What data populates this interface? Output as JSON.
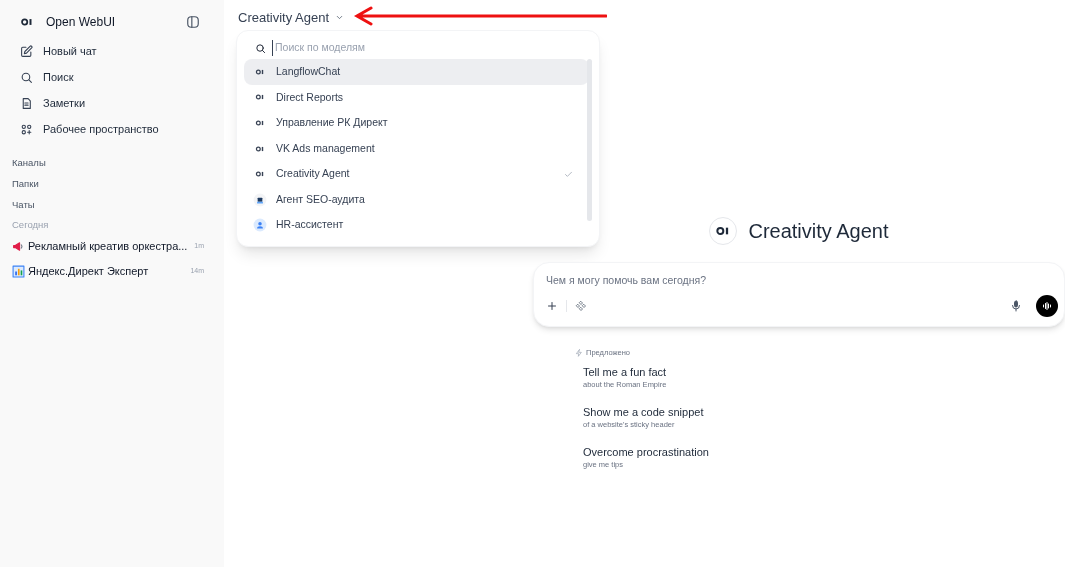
{
  "sidebar": {
    "app_name": "Open WebUI",
    "nav": [
      {
        "kind": "new-chat",
        "label": "Новый чат"
      },
      {
        "kind": "search",
        "label": "Поиск"
      },
      {
        "kind": "notes",
        "label": "Заметки"
      },
      {
        "kind": "workspace",
        "label": "Рабочее пространство"
      }
    ],
    "sections": [
      "Каналы",
      "Папки",
      "Чаты"
    ],
    "group_label": "Сегодня",
    "chats": [
      {
        "kind": "megaphone",
        "title": "Рекламный креатив оркестра...",
        "time": "1m"
      },
      {
        "kind": "chart",
        "title": "Яндекс.Директ Эксперт",
        "time": "14m"
      }
    ]
  },
  "model_selector": {
    "label": "Creativity Agent",
    "expanded": true,
    "search_placeholder": "Поиск по моделям",
    "models": [
      {
        "kind": "logo",
        "name": "LangflowChat",
        "highlighted": true,
        "selected": false
      },
      {
        "kind": "logo",
        "name": "Direct Reports",
        "highlighted": false,
        "selected": false
      },
      {
        "kind": "logo",
        "name": "Управление РК Директ",
        "highlighted": false,
        "selected": false
      },
      {
        "kind": "logo",
        "name": "VK Ads management",
        "highlighted": false,
        "selected": false
      },
      {
        "kind": "logo",
        "name": "Creativity Agent",
        "highlighted": false,
        "selected": true
      },
      {
        "kind": "robot",
        "name": "Агент SEO-аудита",
        "highlighted": false,
        "selected": false
      },
      {
        "kind": "person",
        "name": "HR-ассистент",
        "highlighted": false,
        "selected": false
      }
    ]
  },
  "chat": {
    "title": "Creativity Agent",
    "input_placeholder": "Чем я могу помочь вам сегодня?",
    "suggested_label": "Предложено",
    "suggestions": [
      {
        "title": "Tell me a fun fact",
        "subtitle": "about the Roman Empire"
      },
      {
        "title": "Show me a code snippet",
        "subtitle": "of a website's sticky header"
      },
      {
        "title": "Overcome procrastination",
        "subtitle": "give me tips"
      }
    ]
  }
}
